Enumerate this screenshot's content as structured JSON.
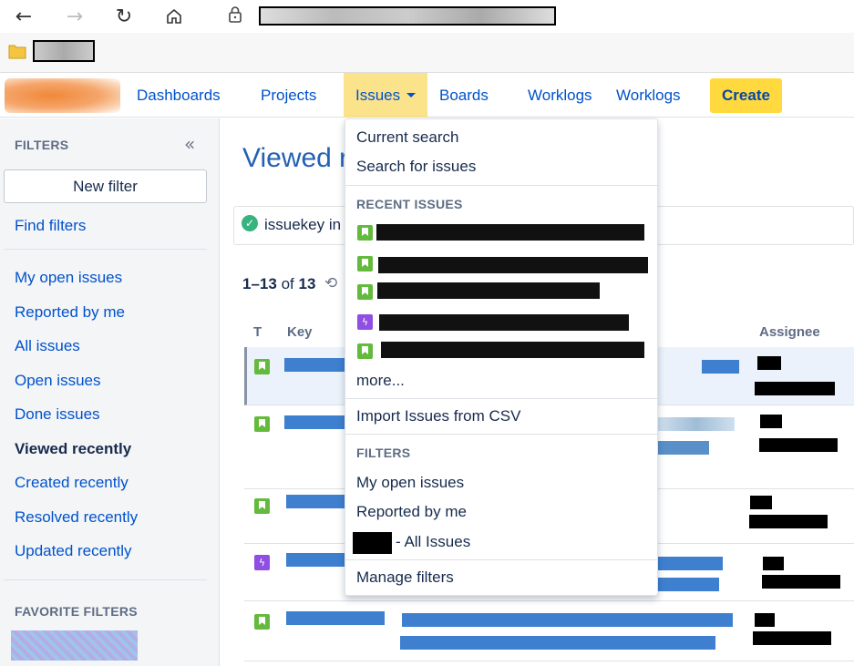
{
  "nav": {
    "dashboards": "Dashboards",
    "projects": "Projects",
    "issues": "Issues",
    "boards": "Boards",
    "worklogs1": "Worklogs",
    "worklogs2": "Worklogs",
    "create": "Create"
  },
  "sidebar": {
    "filters_heading": "FILTERS",
    "new_filter": "New filter",
    "find_filters": "Find filters",
    "items": [
      "My open issues",
      "Reported by me",
      "All issues",
      "Open issues",
      "Done issues",
      "Viewed recently",
      "Created recently",
      "Resolved recently",
      "Updated recently"
    ],
    "current": "Viewed recently",
    "favorite_heading": "FAVORITE FILTERS"
  },
  "main": {
    "title": "Viewed r",
    "query": "issuekey in",
    "count_range": "1–13",
    "count_of": "of",
    "count_total": "13",
    "columns": {
      "type": "T",
      "key": "Key",
      "assignee": "Assignee"
    }
  },
  "dropdown": {
    "current_search": "Current search",
    "search_for_issues": "Search for issues",
    "recent_heading": "RECENT ISSUES",
    "more": "more...",
    "import_csv": "Import Issues from CSV",
    "filters_heading": "FILTERS",
    "my_open": "My open issues",
    "reported_by_me": "Reported by me",
    "all_issues_suffix": "- All Issues",
    "manage_filters": "Manage filters"
  },
  "colors": {
    "link": "#0052cc",
    "active_nav": "#fbe38c",
    "create_btn": "#ffd93d",
    "story": "#63ba3c",
    "epic": "#904ee2"
  }
}
